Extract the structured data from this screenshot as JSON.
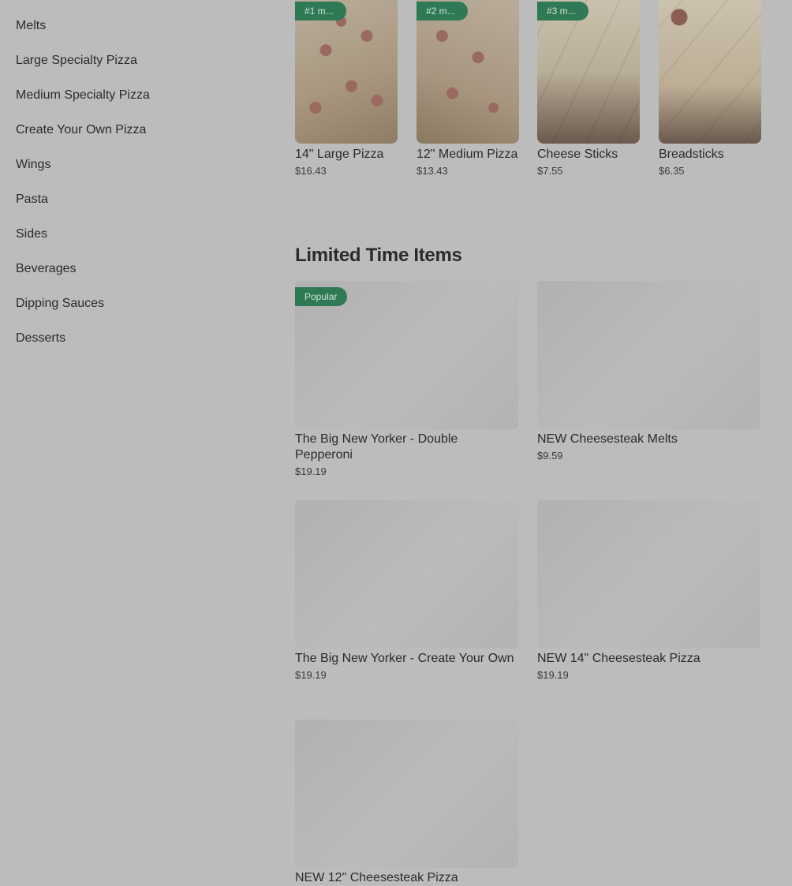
{
  "sidebar": {
    "categories": [
      "Melts",
      "Large Specialty Pizza",
      "Medium Specialty Pizza",
      "Create Your Own Pizza",
      "Wings",
      "Pasta",
      "Sides",
      "Beverages",
      "Dipping Sauces",
      "Desserts"
    ]
  },
  "popular": {
    "items": [
      {
        "badge": "#1 m...",
        "name": "14\" Large Pizza",
        "price": "$16.43"
      },
      {
        "badge": "#2 m...",
        "name": "12\" Medium Pizza",
        "price": "$13.43"
      },
      {
        "badge": "#3 m...",
        "name": "Cheese Sticks",
        "price": "$7.55"
      },
      {
        "badge": "",
        "name": "Breadsticks",
        "price": "$6.35"
      }
    ]
  },
  "limited": {
    "title": "Limited Time Items",
    "items": [
      {
        "badge": "Popular",
        "name": "The Big New Yorker - Double Pepperoni",
        "price": "$19.19"
      },
      {
        "badge": "",
        "name": "NEW Cheesesteak Melts",
        "price": "$9.59"
      },
      {
        "badge": "",
        "name": "The Big New Yorker - Create Your Own",
        "price": "$19.19"
      },
      {
        "badge": "",
        "name": "NEW 14\" Cheesesteak Pizza",
        "price": "$19.19"
      },
      {
        "badge": "",
        "name": "NEW 12\" Cheesesteak Pizza",
        "price": ""
      }
    ]
  },
  "colors": {
    "overlay_background": "#bcbcbc",
    "badge_green": "#2f7a55"
  }
}
